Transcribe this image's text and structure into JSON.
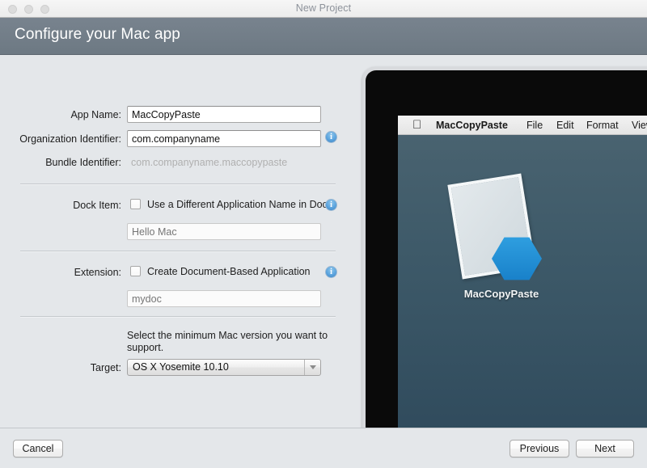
{
  "window": {
    "title": "New Project",
    "traffic_lights": [
      "close",
      "minimize",
      "zoom"
    ]
  },
  "header": {
    "title": "Configure your Mac app",
    "background_color": "#6d7983"
  },
  "form": {
    "app_name": {
      "label": "App Name:",
      "value": "MacCopyPaste",
      "placeholder": ""
    },
    "organization_identifier": {
      "label": "Organization Identifier:",
      "value": "com.companyname",
      "placeholder": "",
      "info": "i"
    },
    "bundle_identifier": {
      "label": "Bundle Identifier:",
      "value": "com.companyname.maccopypaste"
    },
    "dock_item": {
      "label": "Dock Item:",
      "checkbox_label": "Use a Different Application Name in Dock",
      "checked": false,
      "field_placeholder": "Hello Mac",
      "field_value": "",
      "info": "i"
    },
    "extension": {
      "label": "Extension:",
      "checkbox_label": "Create Document-Based Application",
      "checked": false,
      "field_placeholder": "mydoc",
      "field_value": "",
      "info": "i"
    },
    "target": {
      "help_text": "Select the minimum Mac version you want to support.",
      "label": "Target:",
      "selected": "OS X Yosemite 10.10"
    }
  },
  "preview": {
    "menubar": {
      "apple_logo": "",
      "items": [
        "MacCopyPaste",
        "File",
        "Edit",
        "Format",
        "View"
      ]
    },
    "desktop": {
      "icon_label": "MacCopyPaste",
      "accent_color": "#1880c9",
      "wallpaper_top": "#4b6471",
      "wallpaper_bottom": "#2f4a5c"
    }
  },
  "footer": {
    "cancel_label": "Cancel",
    "previous_label": "Previous",
    "next_label": "Next"
  }
}
